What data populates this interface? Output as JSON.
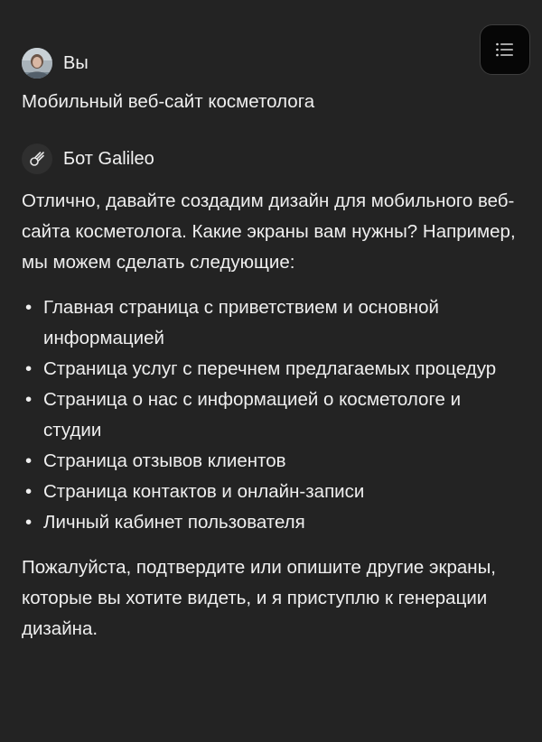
{
  "menu": {
    "icon": "menu-lines-icon"
  },
  "user_message": {
    "author": "Вы",
    "avatar_icon": "user-avatar",
    "text": "Мобильный веб-сайт косметолога"
  },
  "bot_message": {
    "author": "Бот Galileo",
    "avatar_icon": "galileo-logo-icon",
    "intro": "Отлично, давайте создадим дизайн для мобильного веб-сайта косметолога. Какие экраны вам нужны? Например, мы можем сделать следующие:",
    "bullet": "•",
    "options": [
      "Главная страница с приветствием и основной информацией",
      "Страница услуг с перечнем предлагаемых процедур",
      "Страница о нас с информацией о косметологе и студии",
      "Страница отзывов клиентов",
      "Страница контактов и онлайн-записи",
      "Личный кабинет пользователя"
    ],
    "outro": "Пожалуйста, подтвердите или опишите другие экраны, которые вы хотите видеть, и я приступлю к генерации дизайна."
  }
}
